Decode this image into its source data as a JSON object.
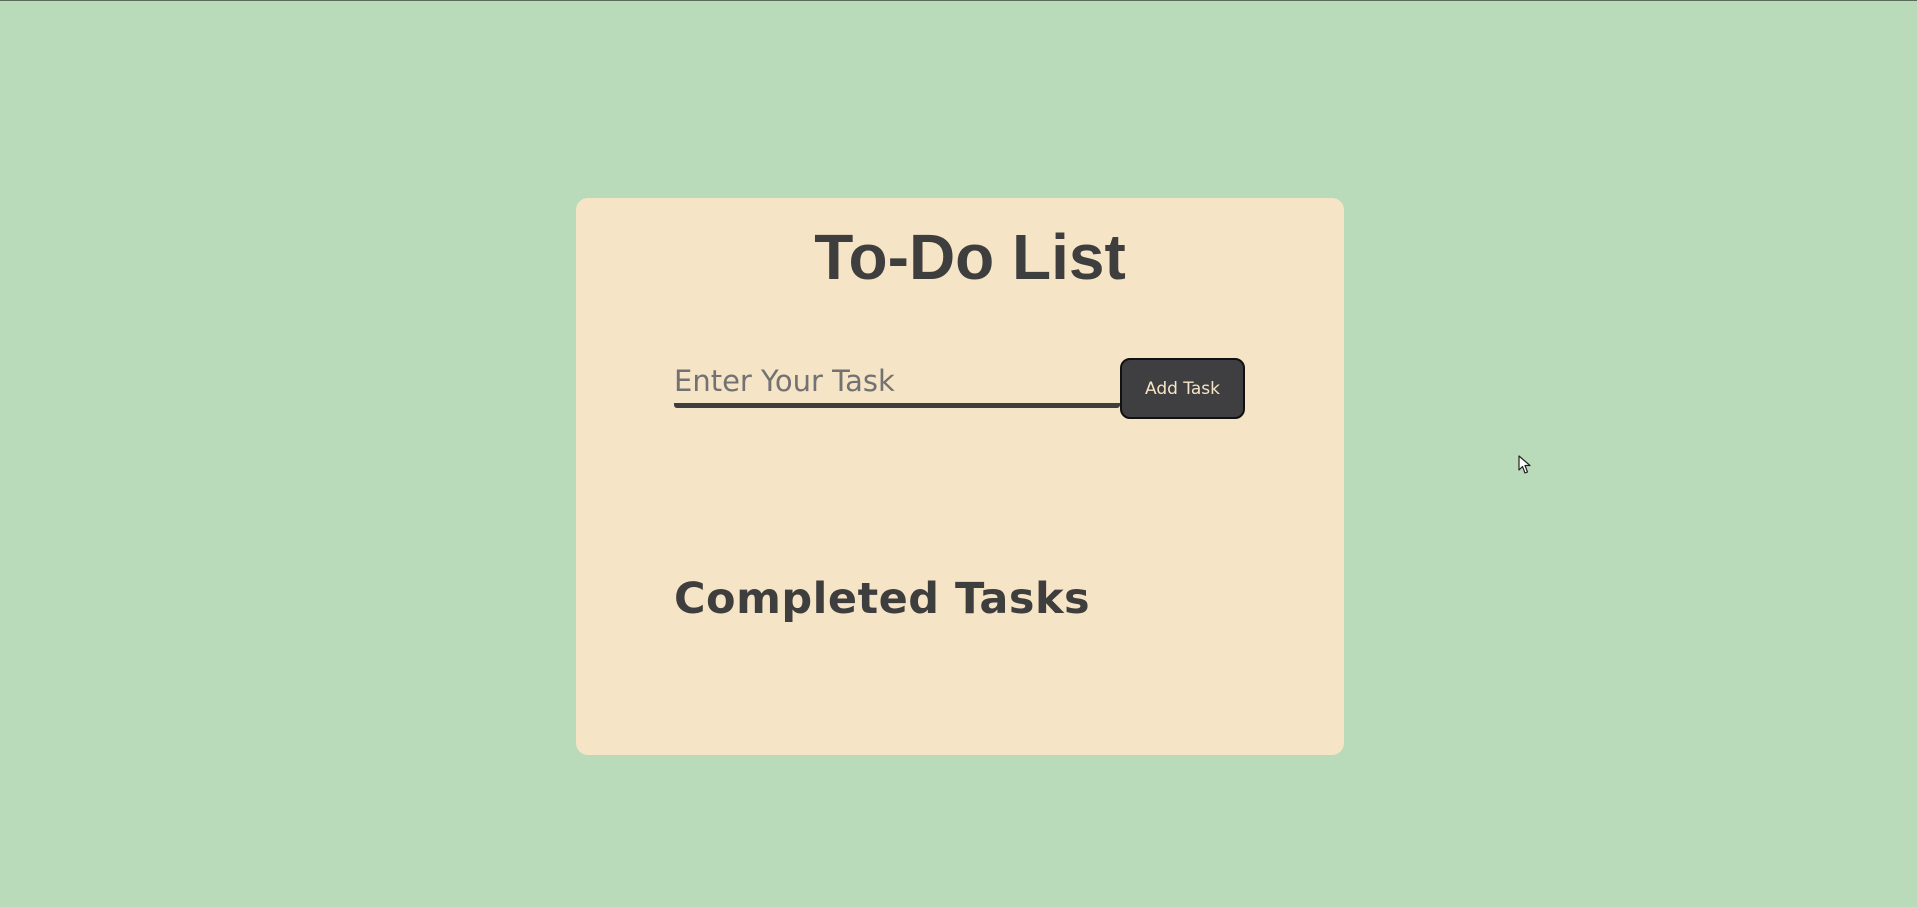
{
  "app": {
    "title": "To-Do List"
  },
  "input": {
    "value": "",
    "placeholder": "Enter Your Task"
  },
  "buttons": {
    "add_label": "Add Task"
  },
  "tasks": [],
  "completed": {
    "heading": "Completed Tasks",
    "items": []
  },
  "colors": {
    "page_background": "#badbba",
    "card_background": "#f6e4c6",
    "text_dark": "#3e3e3e",
    "button_background": "#3f3f41",
    "button_text": "#f6e4c6"
  },
  "icons": {
    "cursor": "mouse-pointer-icon"
  }
}
